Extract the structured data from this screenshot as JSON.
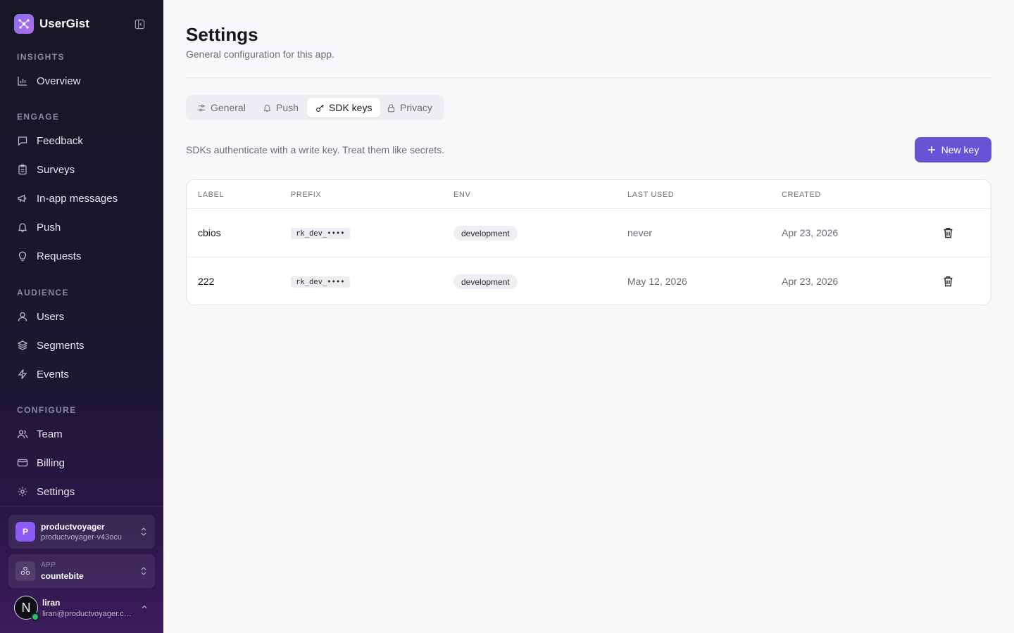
{
  "brand": {
    "name": "UserGist"
  },
  "sidebar": {
    "sections": [
      {
        "label": "INSIGHTS",
        "items": [
          {
            "label": "Overview",
            "icon": "bar-chart-icon"
          }
        ]
      },
      {
        "label": "ENGAGE",
        "items": [
          {
            "label": "Feedback",
            "icon": "message-square-icon"
          },
          {
            "label": "Surveys",
            "icon": "clipboard-icon"
          },
          {
            "label": "In-app messages",
            "icon": "megaphone-icon"
          },
          {
            "label": "Push",
            "icon": "bell-icon"
          },
          {
            "label": "Requests",
            "icon": "lightbulb-icon"
          }
        ]
      },
      {
        "label": "AUDIENCE",
        "items": [
          {
            "label": "Users",
            "icon": "user-icon"
          },
          {
            "label": "Segments",
            "icon": "layers-icon"
          },
          {
            "label": "Events",
            "icon": "zap-icon"
          }
        ]
      },
      {
        "label": "CONFIGURE",
        "items": [
          {
            "label": "Team",
            "icon": "users-icon"
          },
          {
            "label": "Billing",
            "icon": "credit-card-icon"
          },
          {
            "label": "Settings",
            "icon": "gear-icon"
          }
        ]
      }
    ],
    "org": {
      "initial": "P",
      "name": "productvoyager",
      "slug": "productvoyager-v43ocu"
    },
    "app": {
      "caption": "APP",
      "name": "countebite"
    },
    "user": {
      "initial": "N",
      "name": "liran",
      "email": "liran@productvoyager.co..."
    }
  },
  "page": {
    "title": "Settings",
    "subtitle": "General configuration for this app."
  },
  "tabs": [
    {
      "label": "General",
      "icon": "sliders-icon",
      "active": false
    },
    {
      "label": "Push",
      "icon": "bell-icon",
      "active": false
    },
    {
      "label": "SDK keys",
      "icon": "key-icon",
      "active": true
    },
    {
      "label": "Privacy",
      "icon": "lock-icon",
      "active": false
    }
  ],
  "sdk": {
    "description": "SDKs authenticate with a write key. Treat them like secrets.",
    "new_key_label": "New key",
    "columns": [
      "LABEL",
      "PREFIX",
      "ENV",
      "LAST USED",
      "CREATED"
    ],
    "rows": [
      {
        "label": "cbios",
        "prefix": "rk_dev_••••",
        "env": "development",
        "last_used": "never",
        "created": "Apr 23, 2026"
      },
      {
        "label": "222",
        "prefix": "rk_dev_••••",
        "env": "development",
        "last_used": "May 12, 2026",
        "created": "Apr 23, 2026"
      }
    ]
  },
  "colors": {
    "accent": "#6a52d6",
    "sidebar_bg": "#171727",
    "status_online": "#22c55e"
  }
}
